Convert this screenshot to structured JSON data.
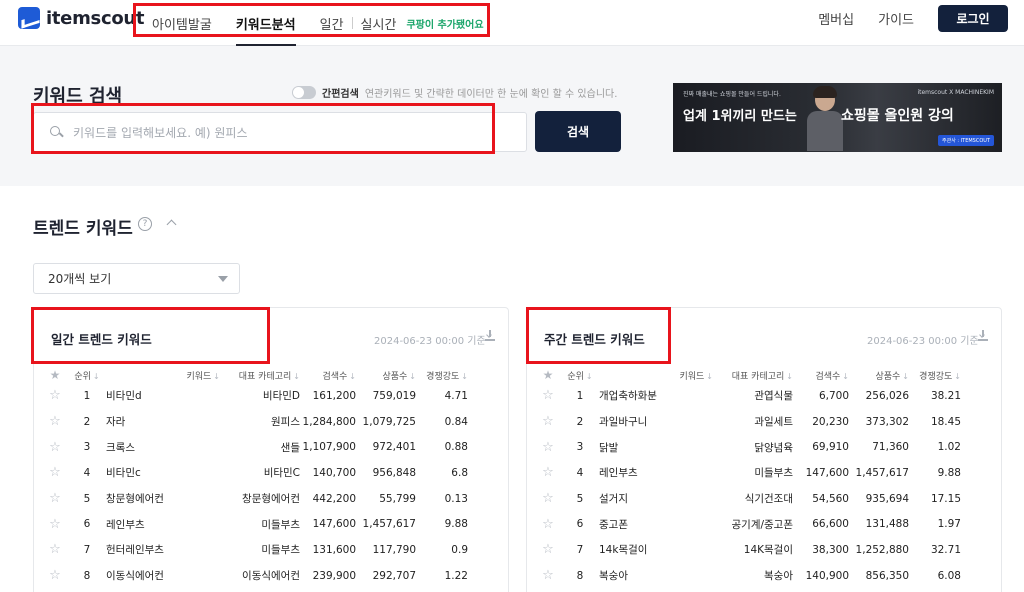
{
  "header": {
    "logo_text": "itemscout",
    "nav": [
      {
        "label": "아이템발굴",
        "active": false
      },
      {
        "label": "키워드분석",
        "active": true
      },
      {
        "label": "일간",
        "active": false
      },
      {
        "label": "실시간",
        "active": false
      }
    ],
    "nav_badge": "쿠팡이 추가됐어요",
    "membership_label": "멤버십",
    "guide_label": "가이드",
    "login_label": "로그인"
  },
  "search": {
    "title": "키워드 검색",
    "toggle_label": "간편검색",
    "toggle_desc": "연관키워드 및 간략한 데이터만 한 눈에 확인 할 수 있습니다.",
    "placeholder": "키워드를 입력해보세요. 예) 원피스",
    "button_label": "검색"
  },
  "banner": {
    "small_text": "진짜 매출내는 쇼핑몰 만들어 드립니다.",
    "brand_text": "itemscout X MACHINEKIM",
    "headline_left": "업계 1위끼리 만드는",
    "headline_right": "쇼핑몰 올인원 강의",
    "cta": "주관사 : ITEMSCOUT"
  },
  "trend": {
    "title": "트렌드 키워드",
    "help": "?",
    "view_select": "20개씩 보기",
    "columns": {
      "rank": "순위",
      "keyword": "키워드",
      "category": "대표 카테고리",
      "search": "검색수",
      "products": "상품수",
      "competition": "경쟁강도"
    },
    "daily": {
      "title": "일간 트렌드 키워드",
      "date": "2024-06-23 00:00 기준",
      "rows": [
        {
          "rank": "1",
          "keyword": "비타민d",
          "category": "비타민D",
          "search": "161,200",
          "products": "759,019",
          "competition": "4.71"
        },
        {
          "rank": "2",
          "keyword": "자라",
          "category": "원피스",
          "search": "1,284,800",
          "products": "1,079,725",
          "competition": "0.84"
        },
        {
          "rank": "3",
          "keyword": "크록스",
          "category": "샌들",
          "search": "1,107,900",
          "products": "972,401",
          "competition": "0.88"
        },
        {
          "rank": "4",
          "keyword": "비타민c",
          "category": "비타민C",
          "search": "140,700",
          "products": "956,848",
          "competition": "6.8"
        },
        {
          "rank": "5",
          "keyword": "창문형에어컨",
          "category": "창문형에어컨",
          "search": "442,200",
          "products": "55,799",
          "competition": "0.13"
        },
        {
          "rank": "6",
          "keyword": "레인부츠",
          "category": "미들부츠",
          "search": "147,600",
          "products": "1,457,617",
          "competition": "9.88"
        },
        {
          "rank": "7",
          "keyword": "헌터레인부츠",
          "category": "미들부츠",
          "search": "131,600",
          "products": "117,790",
          "competition": "0.9"
        },
        {
          "rank": "8",
          "keyword": "이동식에어컨",
          "category": "이동식에어컨",
          "search": "239,900",
          "products": "292,707",
          "competition": "1.22"
        }
      ]
    },
    "weekly": {
      "title": "주간 트렌드 키워드",
      "date": "2024-06-23 00:00 기준",
      "rows": [
        {
          "rank": "1",
          "keyword": "개업축하화분",
          "category": "관엽식물",
          "search": "6,700",
          "products": "256,026",
          "competition": "38.21"
        },
        {
          "rank": "2",
          "keyword": "과일바구니",
          "category": "과일세트",
          "search": "20,230",
          "products": "373,302",
          "competition": "18.45"
        },
        {
          "rank": "3",
          "keyword": "닭발",
          "category": "닭양념육",
          "search": "69,910",
          "products": "71,360",
          "competition": "1.02"
        },
        {
          "rank": "4",
          "keyword": "레인부츠",
          "category": "미들부츠",
          "search": "147,600",
          "products": "1,457,617",
          "competition": "9.88"
        },
        {
          "rank": "5",
          "keyword": "설거지",
          "category": "식기건조대",
          "search": "54,560",
          "products": "935,694",
          "competition": "17.15"
        },
        {
          "rank": "6",
          "keyword": "중고폰",
          "category": "공기계/중고폰",
          "search": "66,600",
          "products": "131,488",
          "competition": "1.97"
        },
        {
          "rank": "7",
          "keyword": "14k목걸이",
          "category": "14K목걸이",
          "search": "38,300",
          "products": "1,252,880",
          "competition": "32.71"
        },
        {
          "rank": "8",
          "keyword": "복숭아",
          "category": "복숭아",
          "search": "140,900",
          "products": "856,350",
          "competition": "6.08"
        }
      ]
    }
  },
  "colors": {
    "highlight_box": "#e8141c",
    "primary_dark": "#13213c",
    "badge_green": "#1aa56a",
    "logo_blue": "#1e5bd6"
  }
}
